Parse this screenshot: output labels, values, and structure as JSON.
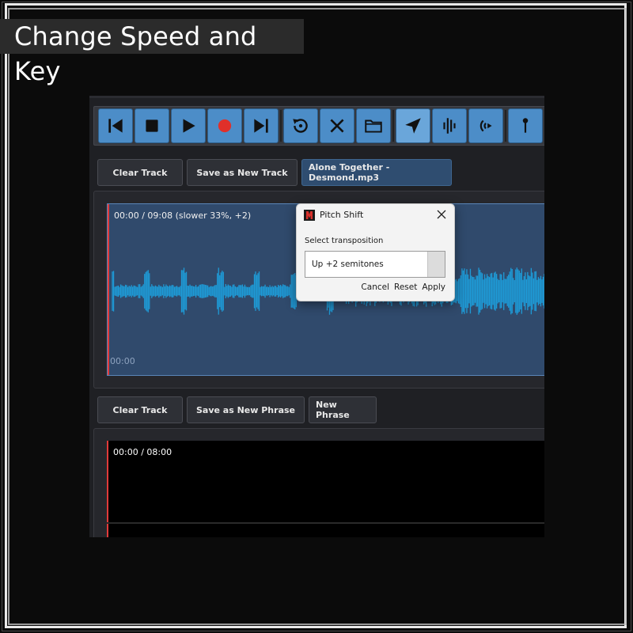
{
  "header": {
    "title": "Change Speed and Key"
  },
  "toolbar": {
    "buttons": [
      {
        "name": "skip-back-button",
        "icon": "skip-back-icon"
      },
      {
        "name": "stop-button",
        "icon": "stop-icon"
      },
      {
        "name": "play-button",
        "icon": "play-icon"
      },
      {
        "name": "record-button",
        "icon": "record-icon"
      },
      {
        "name": "skip-forward-button",
        "icon": "skip-forward-icon"
      },
      {
        "name": "loop-button",
        "icon": "loop-icon"
      },
      {
        "name": "delete-button",
        "icon": "close-icon"
      },
      {
        "name": "open-folder-button",
        "icon": "folder-icon"
      },
      {
        "name": "send-button",
        "icon": "send-icon"
      },
      {
        "name": "waveform-button",
        "icon": "waveform-icon"
      },
      {
        "name": "broadcast-button",
        "icon": "broadcast-icon"
      },
      {
        "name": "marker-button",
        "icon": "pin-icon"
      }
    ],
    "colors": {
      "button": "#4c8dc8",
      "active": "#6aa6da",
      "record": "#e0302a"
    }
  },
  "track1": {
    "clear_label": "Clear Track",
    "save_label": "Save as New Track",
    "file_label": "Alone Together - Desmond.mp3",
    "time_readout": "00:00 / 09:08 (slower 33%, +2)",
    "time_start": "00:00"
  },
  "track2": {
    "clear_label": "Clear Track",
    "save_label": "Save as New Phrase",
    "new_label": "New Phrase",
    "time_readout": "00:00 / 08:00"
  },
  "dialog": {
    "title": "Pitch Shift",
    "label": "Select transposition",
    "selected_value": "Up +2 semitones",
    "cancel": "Cancel",
    "reset": "Reset",
    "apply": "Apply"
  }
}
